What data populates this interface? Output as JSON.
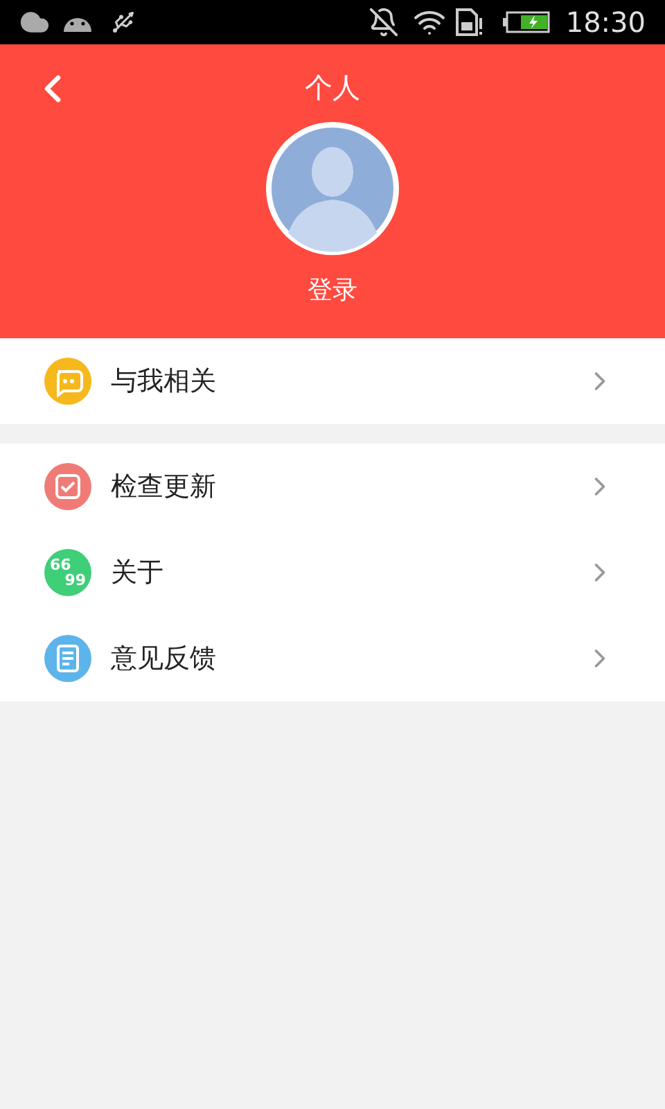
{
  "status_bar": {
    "time": "18:30"
  },
  "header": {
    "title": "个人",
    "login": "登录"
  },
  "groups": [
    {
      "items": [
        {
          "label": "与我相关",
          "kind": "chat",
          "color": "#f6b81c"
        }
      ]
    },
    {
      "items": [
        {
          "label": "检查更新",
          "kind": "check",
          "color": "#f07b76"
        },
        {
          "label": "关于",
          "kind": "text",
          "color": "#3ecf78",
          "icon_text": [
            "66",
            "99"
          ]
        },
        {
          "label": "意见反馈",
          "kind": "doc",
          "color": "#5db4ea"
        }
      ]
    }
  ]
}
